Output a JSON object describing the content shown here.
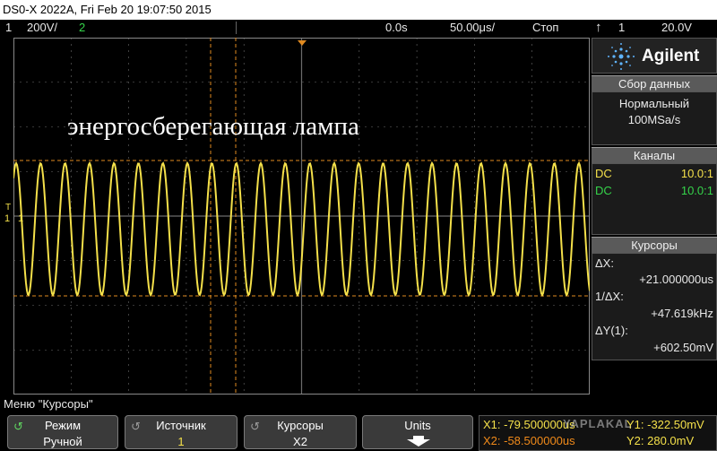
{
  "title": "DS0-X 2022A, Fri Feb 20 19:07:50 2015",
  "status": {
    "ch1_num": "1",
    "ch1_scale": "200V/",
    "ch2_num": "2",
    "time_pos": "0.0s",
    "time_scale": "50.00μs/",
    "run_state": "Стоп",
    "trig_icon": "trigger-edge-icon",
    "trig_ch": "1",
    "trig_level": "20.0V"
  },
  "screen": {
    "annotation": "энергосберегающая лампа",
    "ch1_marker": "1",
    "trigger_marker": "T",
    "colors": {
      "trace": "#f4e04a",
      "grid": "#6b6b6b",
      "cursor": "#e08a20"
    }
  },
  "side": {
    "brand": "Agilent",
    "acq": {
      "head": "Сбор данных",
      "mode": "Нормальный",
      "rate": "100MSa/s"
    },
    "channels": {
      "head": "Каналы",
      "rows": [
        {
          "coupling": "DC",
          "probe": "10.0:1",
          "color": "#f4e04a"
        },
        {
          "coupling": "DC",
          "probe": "10.0:1",
          "color": "#35d44a"
        }
      ]
    },
    "cursors": {
      "head": "Курсоры",
      "dx_label": "ΔX:",
      "dx_value": "+21.000000us",
      "inv_label": "1/ΔX:",
      "inv_value": "+47.619kHz",
      "dy_label": "ΔY(1):",
      "dy_value": "+602.50mV"
    }
  },
  "menu_label": "Меню \"Курсоры\"",
  "softkeys": [
    {
      "line1": "Режим",
      "line2": "Ручной"
    },
    {
      "line1": "Источник",
      "line2": "1"
    },
    {
      "line1": "Курсоры",
      "line2": "X2"
    },
    {
      "line1": "Units",
      "line2": ""
    }
  ],
  "cursor_readout": {
    "x1": "X1: -79.500000us",
    "x2": "X2: -58.500000us",
    "y1": "Y1: -322.50mV",
    "y2": "Y2: 280.0mV"
  },
  "watermark": "YAPLAKAL"
}
